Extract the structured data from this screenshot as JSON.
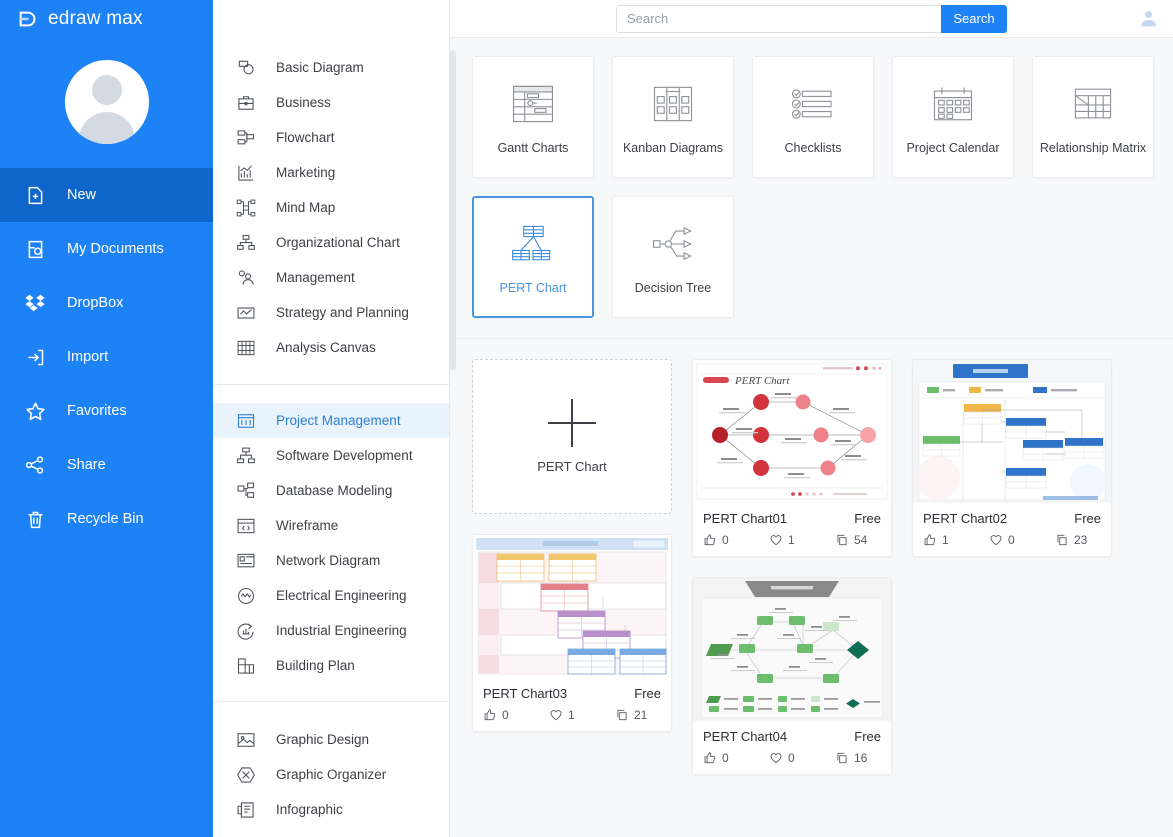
{
  "brand": {
    "name": "edraw max",
    "logo_icon": "edraw-logo-icon"
  },
  "sidebar": {
    "avatar_icon": "user-avatar-icon",
    "items": [
      {
        "label": "New",
        "icon": "new-document-icon",
        "active": true
      },
      {
        "label": "My Documents",
        "icon": "my-documents-icon",
        "active": false
      },
      {
        "label": "DropBox",
        "icon": "dropbox-icon",
        "active": false
      },
      {
        "label": "Import",
        "icon": "import-icon",
        "active": false
      },
      {
        "label": "Favorites",
        "icon": "star-icon",
        "active": false
      },
      {
        "label": "Share",
        "icon": "share-icon",
        "active": false
      },
      {
        "label": "Recycle Bin",
        "icon": "trash-icon",
        "active": false
      }
    ]
  },
  "categories": {
    "group1": [
      {
        "label": "Basic Diagram",
        "icon": "basic-diagram-icon"
      },
      {
        "label": "Business",
        "icon": "briefcase-icon"
      },
      {
        "label": "Flowchart",
        "icon": "flowchart-icon"
      },
      {
        "label": "Marketing",
        "icon": "bar-chart-icon"
      },
      {
        "label": "Mind Map",
        "icon": "mind-map-icon"
      },
      {
        "label": "Organizational Chart",
        "icon": "org-chart-icon"
      },
      {
        "label": "Management",
        "icon": "management-icon"
      },
      {
        "label": "Strategy and Planning",
        "icon": "strategy-icon"
      },
      {
        "label": "Analysis Canvas",
        "icon": "analysis-canvas-icon"
      }
    ],
    "group2": [
      {
        "label": "Project Management",
        "icon": "project-management-icon",
        "active": true
      },
      {
        "label": "Software Development",
        "icon": "software-development-icon"
      },
      {
        "label": "Database Modeling",
        "icon": "database-modeling-icon"
      },
      {
        "label": "Wireframe",
        "icon": "wireframe-icon"
      },
      {
        "label": "Network Diagram",
        "icon": "network-diagram-icon"
      },
      {
        "label": "Electrical Engineering",
        "icon": "electrical-engineering-icon"
      },
      {
        "label": "Industrial Engineering",
        "icon": "industrial-engineering-icon"
      },
      {
        "label": "Building Plan",
        "icon": "building-plan-icon"
      }
    ],
    "group3": [
      {
        "label": "Graphic Design",
        "icon": "graphic-design-icon"
      },
      {
        "label": "Graphic Organizer",
        "icon": "graphic-organizer-icon"
      },
      {
        "label": "Infographic",
        "icon": "infographic-icon"
      }
    ]
  },
  "search": {
    "value": "",
    "placeholder": "Search",
    "button_label": "Search",
    "user_icon": "account-icon"
  },
  "types": [
    {
      "label": "Gantt Charts",
      "icon": "gantt-chart-icon",
      "selected": false
    },
    {
      "label": "Kanban Diagrams",
      "icon": "kanban-icon",
      "selected": false
    },
    {
      "label": "Checklists",
      "icon": "checklist-icon",
      "selected": false
    },
    {
      "label": "Project Calendar",
      "icon": "calendar-icon",
      "selected": false
    },
    {
      "label": "Relationship Matrix",
      "icon": "matrix-icon",
      "selected": false
    },
    {
      "label": "PERT Chart",
      "icon": "pert-chart-icon",
      "selected": true
    },
    {
      "label": "Decision Tree",
      "icon": "decision-tree-icon",
      "selected": false
    }
  ],
  "gallery": {
    "new_card": {
      "label": "PERT Chart",
      "icon": "plus-icon"
    },
    "templates": [
      {
        "title": "PERT Chart01",
        "price": "Free",
        "likes": "0",
        "favorites": "1",
        "copies": "54",
        "theme": "red-network"
      },
      {
        "title": "PERT Chart02",
        "price": "Free",
        "likes": "1",
        "favorites": "0",
        "copies": "23",
        "theme": "blue-boxes"
      },
      {
        "title": "PERT Chart03",
        "price": "Free",
        "likes": "0",
        "favorites": "1",
        "copies": "21",
        "theme": "pink-swimlane"
      },
      {
        "title": "PERT Chart04",
        "price": "Free",
        "likes": "0",
        "favorites": "0",
        "copies": "16",
        "theme": "green-network"
      }
    ],
    "stat_icons": {
      "like": "thumbs-up-icon",
      "favorite": "heart-icon",
      "copy": "copy-icon"
    }
  },
  "colors": {
    "brand_blue": "#1d82f5",
    "active_blue": "#0f66ca",
    "selected_border": "#4b94e0",
    "page_bg": "#f7f8fa"
  }
}
